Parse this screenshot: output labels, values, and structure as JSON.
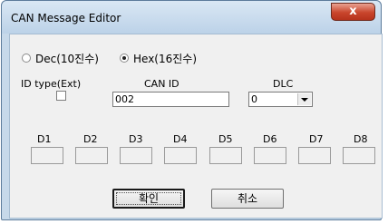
{
  "window": {
    "title": "CAN Message Editor",
    "close_glyph": "x"
  },
  "format": {
    "dec_label": "Dec(10진수)",
    "hex_label": "Hex(16진수)",
    "selected": "hex"
  },
  "id_type": {
    "label": "ID type(Ext)",
    "checked": false
  },
  "can_id": {
    "label": "CAN ID",
    "value": "002"
  },
  "dlc": {
    "label": "DLC",
    "value": "0"
  },
  "data_bytes": {
    "labels": [
      "D1",
      "D2",
      "D3",
      "D4",
      "D5",
      "D6",
      "D7",
      "D8"
    ],
    "values": [
      "",
      "",
      "",
      "",
      "",
      "",
      "",
      ""
    ]
  },
  "buttons": {
    "ok_label": "확인",
    "cancel_label": "취소"
  }
}
